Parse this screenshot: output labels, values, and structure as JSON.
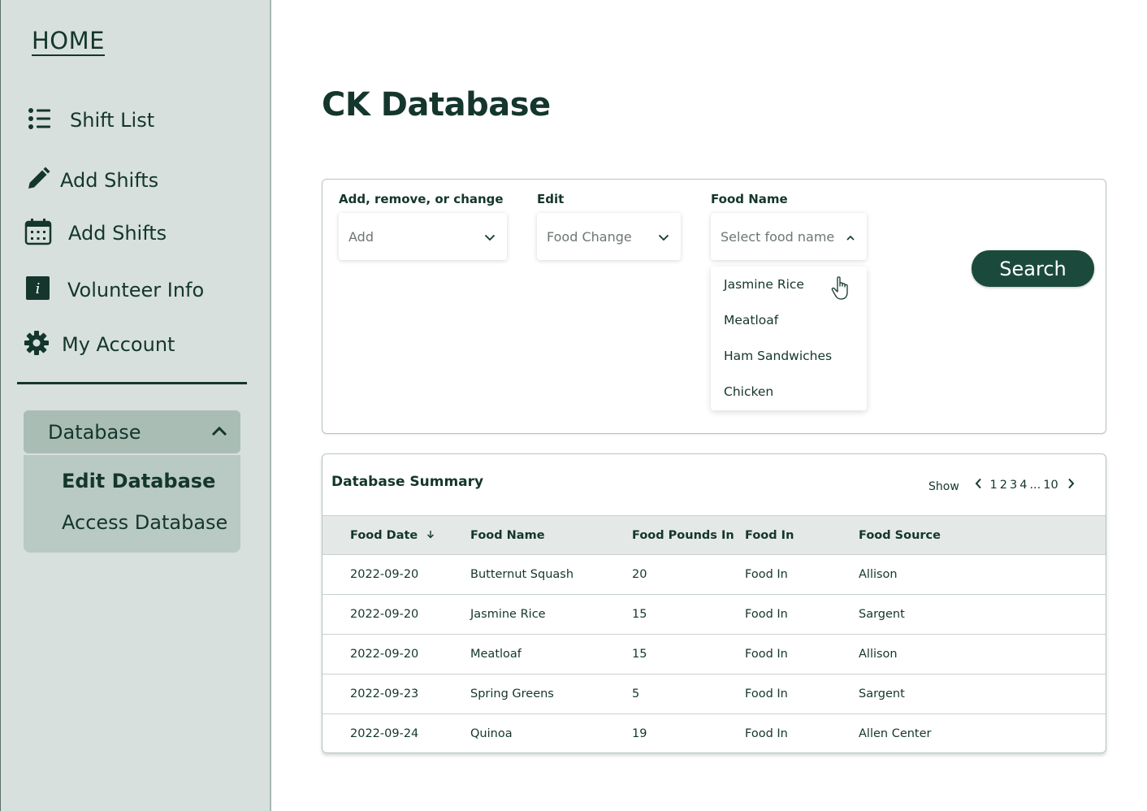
{
  "sidebar": {
    "home": "HOME",
    "nav": [
      {
        "label": "Shift List",
        "icon": "list-icon"
      },
      {
        "label": "Add Shifts",
        "icon": "pencil-icon"
      },
      {
        "label": "Add Shifts",
        "icon": "calendar-icon"
      },
      {
        "label": "Volunteer Info",
        "icon": "info-icon"
      },
      {
        "label": "My Account",
        "icon": "gear-icon"
      }
    ],
    "database": {
      "label": "Database",
      "items": [
        "Edit Database",
        "Access Database"
      ]
    }
  },
  "main": {
    "title": "CK Database",
    "filters": {
      "action_label": "Add, remove, or change",
      "action_value": "Add",
      "edit_label": "Edit",
      "edit_value": "Food Change",
      "food_label": "Food Name",
      "food_placeholder": "Select food name",
      "food_options": [
        "Jasmine Rice",
        "Meatloaf",
        "Ham Sandwiches",
        "Chicken"
      ]
    },
    "search_label": "Search",
    "summary": {
      "title": "Database Summary",
      "show_label": "Show",
      "pages": [
        "1",
        "2",
        "3",
        "4",
        "...",
        "10"
      ],
      "columns": [
        "Food Date",
        "Food Name",
        "Food Pounds In",
        "Food In",
        "Food Source"
      ],
      "rows": [
        [
          "2022-09-20",
          "Butternut Squash",
          "20",
          "Food In",
          "Allison"
        ],
        [
          "2022-09-20",
          "Jasmine Rice",
          "15",
          "Food In",
          "Sargent"
        ],
        [
          "2022-09-20",
          "Meatloaf",
          "15",
          "Food In",
          "Allison"
        ],
        [
          "2022-09-23",
          "Spring Greens",
          "5",
          "Food In",
          "Sargent"
        ],
        [
          "2022-09-24",
          "Quinoa",
          "19",
          "Food In",
          "Allen Center"
        ]
      ]
    }
  },
  "colors": {
    "brand": "#14362c",
    "sidebar_bg": "#d7e0dd",
    "accent_button": "#1b4a3d"
  }
}
